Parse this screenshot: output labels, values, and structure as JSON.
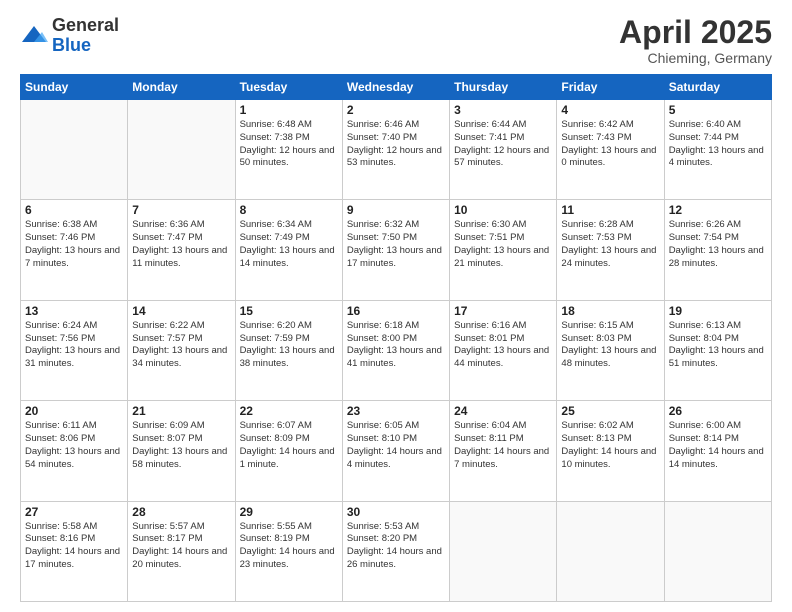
{
  "header": {
    "logo": {
      "general": "General",
      "blue": "Blue"
    },
    "title": "April 2025",
    "subtitle": "Chieming, Germany"
  },
  "weekdays": [
    "Sunday",
    "Monday",
    "Tuesday",
    "Wednesday",
    "Thursday",
    "Friday",
    "Saturday"
  ],
  "weeks": [
    [
      {
        "day": "",
        "info": ""
      },
      {
        "day": "",
        "info": ""
      },
      {
        "day": "1",
        "info": "Sunrise: 6:48 AM\nSunset: 7:38 PM\nDaylight: 12 hours and 50 minutes."
      },
      {
        "day": "2",
        "info": "Sunrise: 6:46 AM\nSunset: 7:40 PM\nDaylight: 12 hours and 53 minutes."
      },
      {
        "day": "3",
        "info": "Sunrise: 6:44 AM\nSunset: 7:41 PM\nDaylight: 12 hours and 57 minutes."
      },
      {
        "day": "4",
        "info": "Sunrise: 6:42 AM\nSunset: 7:43 PM\nDaylight: 13 hours and 0 minutes."
      },
      {
        "day": "5",
        "info": "Sunrise: 6:40 AM\nSunset: 7:44 PM\nDaylight: 13 hours and 4 minutes."
      }
    ],
    [
      {
        "day": "6",
        "info": "Sunrise: 6:38 AM\nSunset: 7:46 PM\nDaylight: 13 hours and 7 minutes."
      },
      {
        "day": "7",
        "info": "Sunrise: 6:36 AM\nSunset: 7:47 PM\nDaylight: 13 hours and 11 minutes."
      },
      {
        "day": "8",
        "info": "Sunrise: 6:34 AM\nSunset: 7:49 PM\nDaylight: 13 hours and 14 minutes."
      },
      {
        "day": "9",
        "info": "Sunrise: 6:32 AM\nSunset: 7:50 PM\nDaylight: 13 hours and 17 minutes."
      },
      {
        "day": "10",
        "info": "Sunrise: 6:30 AM\nSunset: 7:51 PM\nDaylight: 13 hours and 21 minutes."
      },
      {
        "day": "11",
        "info": "Sunrise: 6:28 AM\nSunset: 7:53 PM\nDaylight: 13 hours and 24 minutes."
      },
      {
        "day": "12",
        "info": "Sunrise: 6:26 AM\nSunset: 7:54 PM\nDaylight: 13 hours and 28 minutes."
      }
    ],
    [
      {
        "day": "13",
        "info": "Sunrise: 6:24 AM\nSunset: 7:56 PM\nDaylight: 13 hours and 31 minutes."
      },
      {
        "day": "14",
        "info": "Sunrise: 6:22 AM\nSunset: 7:57 PM\nDaylight: 13 hours and 34 minutes."
      },
      {
        "day": "15",
        "info": "Sunrise: 6:20 AM\nSunset: 7:59 PM\nDaylight: 13 hours and 38 minutes."
      },
      {
        "day": "16",
        "info": "Sunrise: 6:18 AM\nSunset: 8:00 PM\nDaylight: 13 hours and 41 minutes."
      },
      {
        "day": "17",
        "info": "Sunrise: 6:16 AM\nSunset: 8:01 PM\nDaylight: 13 hours and 44 minutes."
      },
      {
        "day": "18",
        "info": "Sunrise: 6:15 AM\nSunset: 8:03 PM\nDaylight: 13 hours and 48 minutes."
      },
      {
        "day": "19",
        "info": "Sunrise: 6:13 AM\nSunset: 8:04 PM\nDaylight: 13 hours and 51 minutes."
      }
    ],
    [
      {
        "day": "20",
        "info": "Sunrise: 6:11 AM\nSunset: 8:06 PM\nDaylight: 13 hours and 54 minutes."
      },
      {
        "day": "21",
        "info": "Sunrise: 6:09 AM\nSunset: 8:07 PM\nDaylight: 13 hours and 58 minutes."
      },
      {
        "day": "22",
        "info": "Sunrise: 6:07 AM\nSunset: 8:09 PM\nDaylight: 14 hours and 1 minute."
      },
      {
        "day": "23",
        "info": "Sunrise: 6:05 AM\nSunset: 8:10 PM\nDaylight: 14 hours and 4 minutes."
      },
      {
        "day": "24",
        "info": "Sunrise: 6:04 AM\nSunset: 8:11 PM\nDaylight: 14 hours and 7 minutes."
      },
      {
        "day": "25",
        "info": "Sunrise: 6:02 AM\nSunset: 8:13 PM\nDaylight: 14 hours and 10 minutes."
      },
      {
        "day": "26",
        "info": "Sunrise: 6:00 AM\nSunset: 8:14 PM\nDaylight: 14 hours and 14 minutes."
      }
    ],
    [
      {
        "day": "27",
        "info": "Sunrise: 5:58 AM\nSunset: 8:16 PM\nDaylight: 14 hours and 17 minutes."
      },
      {
        "day": "28",
        "info": "Sunrise: 5:57 AM\nSunset: 8:17 PM\nDaylight: 14 hours and 20 minutes."
      },
      {
        "day": "29",
        "info": "Sunrise: 5:55 AM\nSunset: 8:19 PM\nDaylight: 14 hours and 23 minutes."
      },
      {
        "day": "30",
        "info": "Sunrise: 5:53 AM\nSunset: 8:20 PM\nDaylight: 14 hours and 26 minutes."
      },
      {
        "day": "",
        "info": ""
      },
      {
        "day": "",
        "info": ""
      },
      {
        "day": "",
        "info": ""
      }
    ]
  ]
}
